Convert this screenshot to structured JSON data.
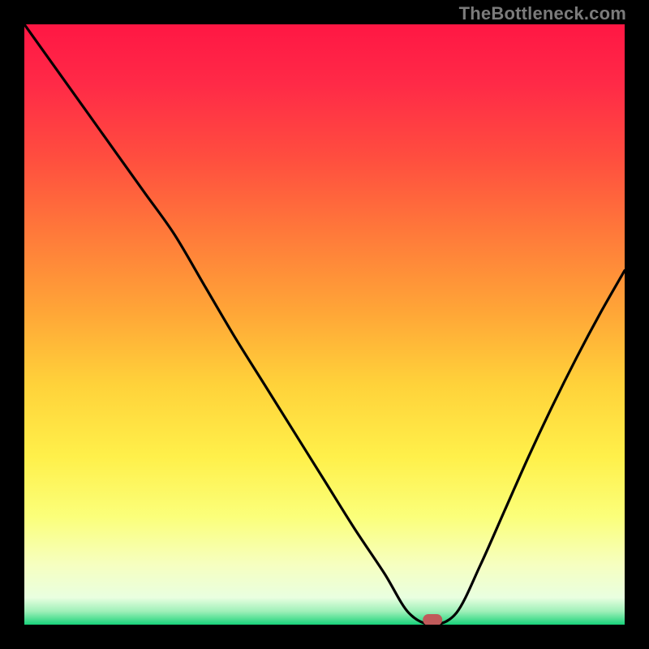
{
  "watermark": "TheBottleneck.com",
  "chart_data": {
    "type": "line",
    "title": "",
    "xlabel": "",
    "ylabel": "",
    "xlim": [
      0,
      100
    ],
    "ylim": [
      0,
      100
    ],
    "x": [
      0,
      5,
      10,
      15,
      20,
      25,
      30,
      35,
      40,
      45,
      50,
      55,
      60,
      64,
      68,
      72,
      76,
      80,
      84,
      88,
      92,
      96,
      100
    ],
    "values": [
      100,
      93,
      86,
      79,
      72,
      65,
      56.5,
      48,
      40,
      32,
      24,
      16,
      8.5,
      2,
      0,
      2,
      10,
      19,
      28,
      36.5,
      44.5,
      52,
      59
    ],
    "series_name": "bottleneck_curve",
    "marker": {
      "x": 68,
      "y": 0,
      "shape": "pill",
      "color": "#c05a5a"
    },
    "gradient_stops": [
      {
        "pos": 0.0,
        "color": "#ff1744"
      },
      {
        "pos": 0.1,
        "color": "#ff2a47"
      },
      {
        "pos": 0.22,
        "color": "#ff4d3f"
      },
      {
        "pos": 0.35,
        "color": "#ff7a3a"
      },
      {
        "pos": 0.48,
        "color": "#ffa637"
      },
      {
        "pos": 0.6,
        "color": "#ffd23a"
      },
      {
        "pos": 0.72,
        "color": "#fff04a"
      },
      {
        "pos": 0.82,
        "color": "#fbff7a"
      },
      {
        "pos": 0.9,
        "color": "#f6ffc0"
      },
      {
        "pos": 0.955,
        "color": "#e9ffe0"
      },
      {
        "pos": 0.978,
        "color": "#9ef0b8"
      },
      {
        "pos": 1.0,
        "color": "#18d27a"
      }
    ]
  }
}
